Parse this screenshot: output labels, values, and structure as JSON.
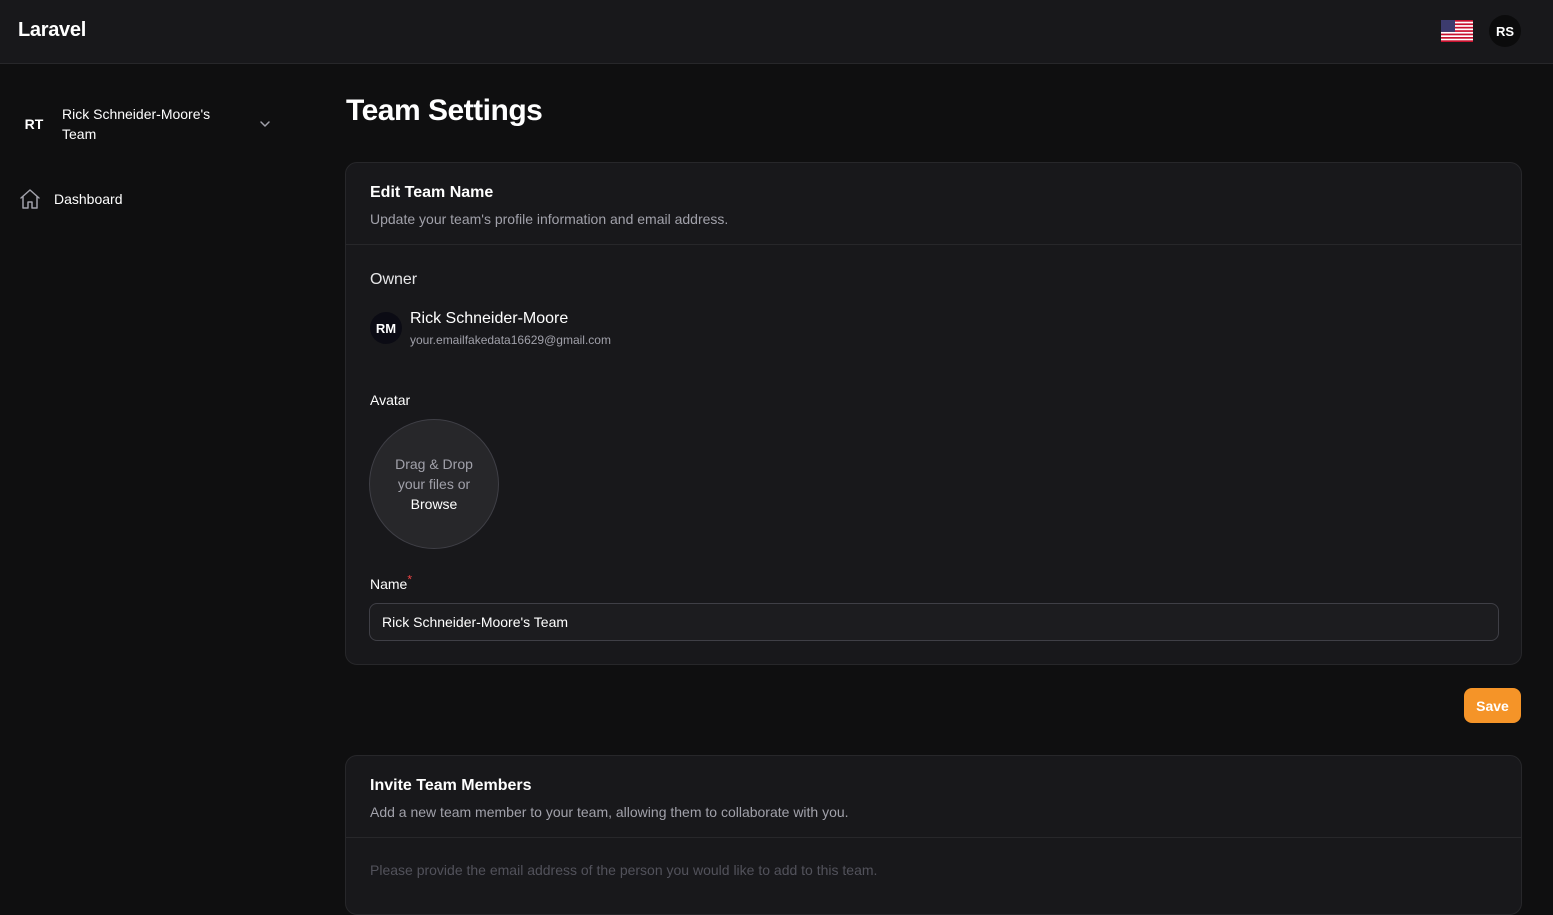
{
  "app": {
    "brand": "Laravel",
    "user_initials": "RS",
    "locale_flag": "us-flag-icon"
  },
  "sidebar": {
    "team": {
      "initials": "RT",
      "name": "Rick Schneider-Moore's Team"
    },
    "items": [
      {
        "label": "Dashboard",
        "icon": "home-icon"
      }
    ]
  },
  "page": {
    "title": "Team Settings"
  },
  "edit_team": {
    "title": "Edit Team Name",
    "description": "Update your team's profile information and email address.",
    "owner_label": "Owner",
    "owner": {
      "initials": "RM",
      "name": "Rick Schneider-Moore",
      "email": "your.emailfakedata16629@gmail.com"
    },
    "avatar_label": "Avatar",
    "dropzone": {
      "line1": "Drag & Drop",
      "line2": "your files or",
      "browse": "Browse"
    },
    "name_label": "Name",
    "required_mark": "*",
    "name_value": "Rick Schneider-Moore's Team",
    "save_label": "Save"
  },
  "invite": {
    "title": "Invite Team Members",
    "description": "Add a new team member to your team, allowing them to collaborate with you.",
    "note": "Please provide the email address of the person you would like to add to this team."
  },
  "colors": {
    "accent": "#f59428",
    "background": "#0f0f10",
    "card": "#18181b",
    "required": "#ef4444"
  }
}
